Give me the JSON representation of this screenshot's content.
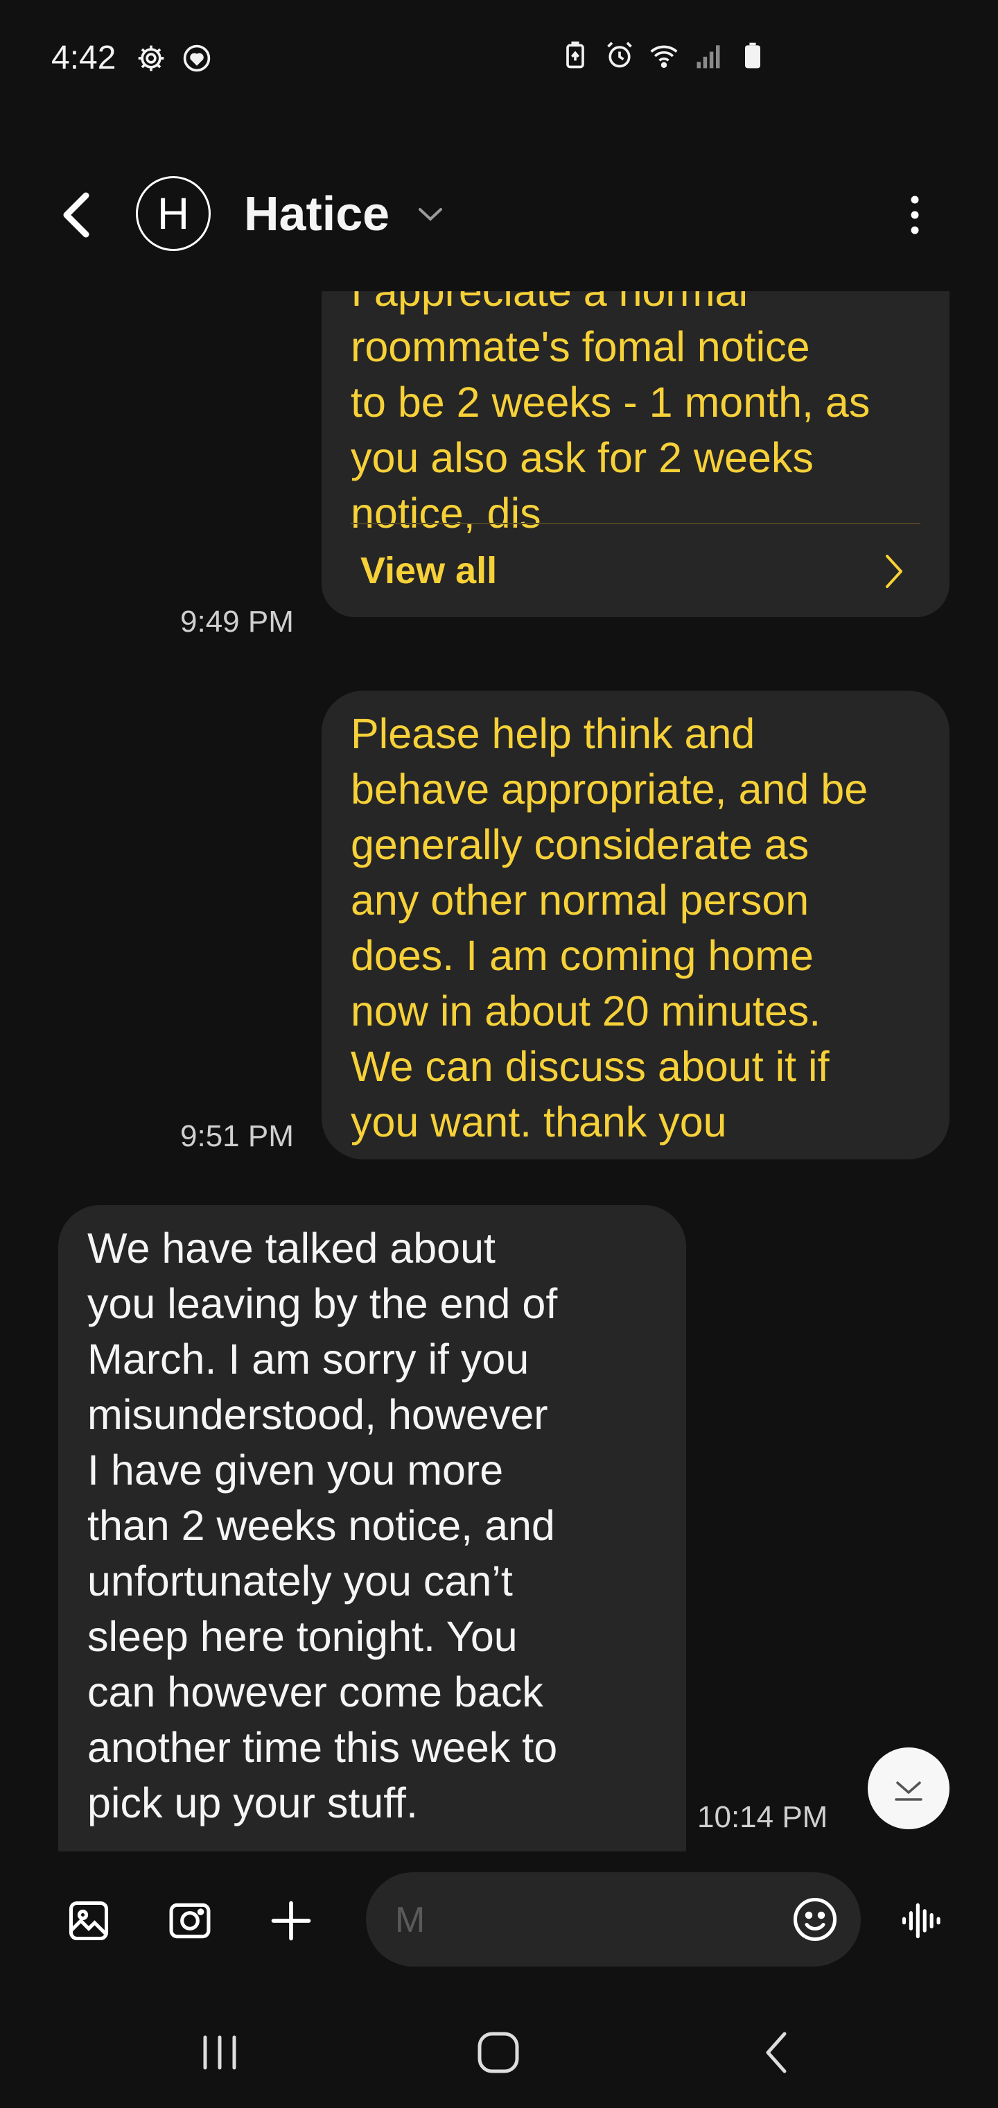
{
  "status_bar": {
    "time": "4:42",
    "left_icons": [
      "gear-icon",
      "heart-shield-icon"
    ],
    "right_icons": [
      "battery-saver-icon",
      "alarm-icon",
      "wifi-icon",
      "signal-icon",
      "battery-icon"
    ]
  },
  "header": {
    "avatar_initial": "H",
    "contact_name": "Hatice"
  },
  "messages": [
    {
      "direction": "outgoing",
      "text": "I appreciate a normal\nroommate's fomal notice\nto be 2 weeks - 1 month, as\nyou also ask for 2 weeks\nnotice, dis",
      "time": "9:49 PM",
      "view_all": "View all"
    },
    {
      "direction": "outgoing",
      "text": "Please help think and\nbehave appropriate, and be\ngenerally considerate as\nany other normal person\ndoes. I am coming home\nnow in about 20 minutes.\nWe can discuss about it if\nyou want. thank you",
      "time": "9:51 PM"
    },
    {
      "direction": "incoming",
      "text": "We have talked about\nyou leaving by the end of\nMarch. I am sorry if you\nmisunderstood, however\nI have given you more\nthan 2 weeks notice, and\nunfortunately you can’t\nsleep here tonight. You\ncan however come back\nanother time this week to\npick up your stuff.",
      "time": "10:14 PM"
    }
  ],
  "input": {
    "placeholder": "M",
    "value": ""
  },
  "colors": {
    "background": "#111111",
    "bubble": "#262626",
    "outgoing_text": "#f7d138",
    "incoming_text": "#f5f5f5"
  }
}
